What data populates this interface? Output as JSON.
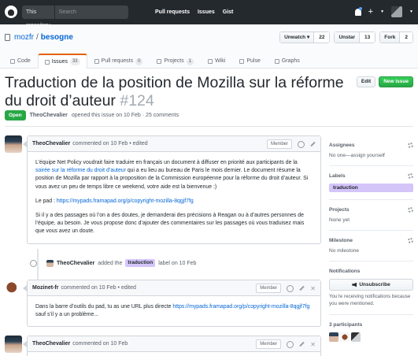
{
  "header": {
    "scope_label": "This repository",
    "search_placeholder": "Search",
    "nav": [
      "Pull requests",
      "Issues",
      "Gist"
    ]
  },
  "repo": {
    "owner": "mozfr",
    "separator": "/",
    "name": "besogne",
    "actions": [
      {
        "label": "Unwatch ▾",
        "count": "22"
      },
      {
        "label": "Unstar",
        "count": "13"
      },
      {
        "label": "Fork",
        "count": "2"
      }
    ],
    "tabs": [
      {
        "label": "Code",
        "counter": ""
      },
      {
        "label": "Issues",
        "counter": "33"
      },
      {
        "label": "Pull requests",
        "counter": "0"
      },
      {
        "label": "Projects",
        "counter": "1"
      },
      {
        "label": "Wiki",
        "counter": ""
      },
      {
        "label": "Pulse",
        "counter": ""
      },
      {
        "label": "Graphs",
        "counter": ""
      }
    ]
  },
  "issue": {
    "title": "Traduction de la position de Mozilla sur la réforme du droit d’auteur",
    "number": "#124",
    "edit_label": "Edit",
    "new_issue_label": "New issue",
    "state": "Open",
    "author": "TheoChevalier",
    "meta_text": "opened this issue on 10 Feb · 25 comments"
  },
  "comments": [
    {
      "author": "TheoChevalier",
      "meta": "commented on 10 Feb • edited",
      "role": "Member",
      "p1_before": "L’équipe Net Policy voudrait faire traduire en français un document à diffuser en priorité aux participants de la ",
      "p1_link": "soirée sur la réforme du droit d’auteur",
      "p1_after": " qui a eu lieu au bureau de Paris le mois dernier. Le document résume la position de Mozilla par rapport à la proposition de la Commission européenne pour la réforme du droit d’auteur. Si vous avez un peu de temps libre ce weekend, votre aide est la bienvenue :)",
      "p2_label": "Le pad : ",
      "p2_link": "https://mypads.framapad.org/p/copyright-mozilla-8qgjf7fg",
      "p3": "Si il y a des passages où l’on a des doutes, je demanderai des précisions à Reagan ou à d’autres personnes de l’équipe, au besoin. Je vous propose donc d’ajouter des commentaires sur les passages où vous traduisez mais que vous avez un doute."
    },
    {
      "author": "Mozinet-fr",
      "meta": "commented on 10 Feb • edited",
      "role": "Member",
      "text_before": "Dans la barre d’outils du pad, tu as une URL plus directe ",
      "link": "https://mypads.framapad.org/p/copyright-mozilla-8qgjf7fg",
      "text_after": " sauf s’il y a un problème..."
    },
    {
      "author": "TheoChevalier",
      "meta": "commented on 10 Feb",
      "role": "Member"
    }
  ],
  "event": {
    "actor": "TheoChevalier",
    "text_before": "added the",
    "label": "traduction",
    "text_after": "label on 10 Feb"
  },
  "sidebar": {
    "assignees_heading": "Assignees",
    "assignees_value": "No one—assign yourself",
    "labels_heading": "Labels",
    "label": "traduction",
    "projects_heading": "Projects",
    "projects_value": "None yet",
    "milestone_heading": "Milestone",
    "milestone_value": "No milestone",
    "notifications_heading": "Notifications",
    "unsubscribe_label": "Unsubscribe",
    "notifications_note": "You’re receiving notifications because you were mentioned.",
    "participants_heading": "3 participants"
  },
  "colors": {
    "header_bg": "#24292e",
    "link": "#0366d6",
    "open_state": "#28a745",
    "label_traduction": "#d4c5f9",
    "tab_accent": "#e36209"
  }
}
